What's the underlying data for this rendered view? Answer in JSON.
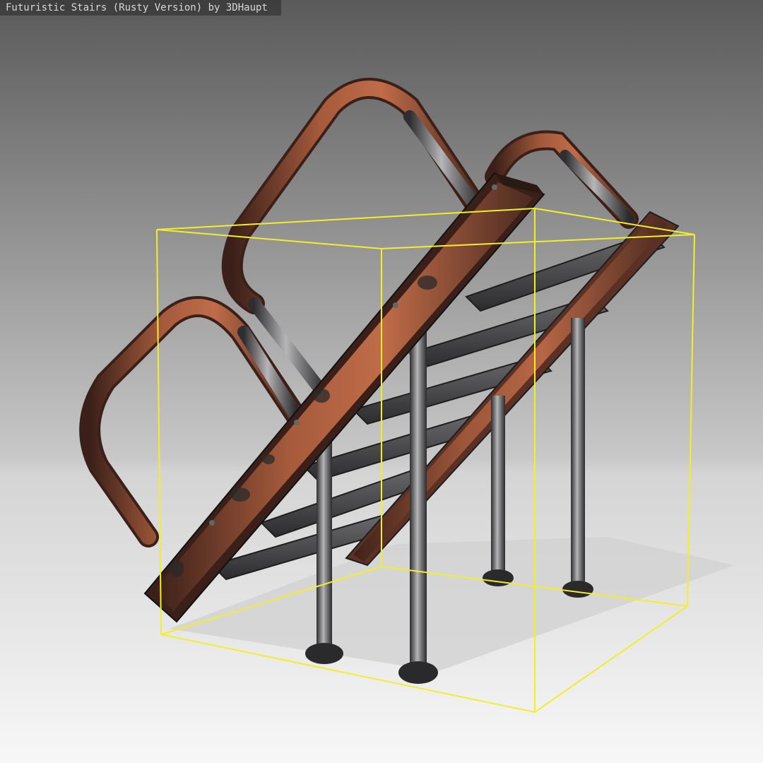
{
  "viewer": {
    "title": "Futuristic Stairs (Rusty Version) by 3DHaupt"
  },
  "scene": {
    "model": "futuristic-stairs",
    "selection_box": true,
    "colors": {
      "bounding_box": "#f2ee2a",
      "rust": "#9a4f33",
      "rust_dark": "#4a2a20",
      "steel": "#8c8c8e",
      "steel_dark": "#3a3a3c",
      "background_top": "#5e5e5e",
      "background_horizon": "#c6c6c6",
      "floor": "#f4f4f4"
    }
  }
}
